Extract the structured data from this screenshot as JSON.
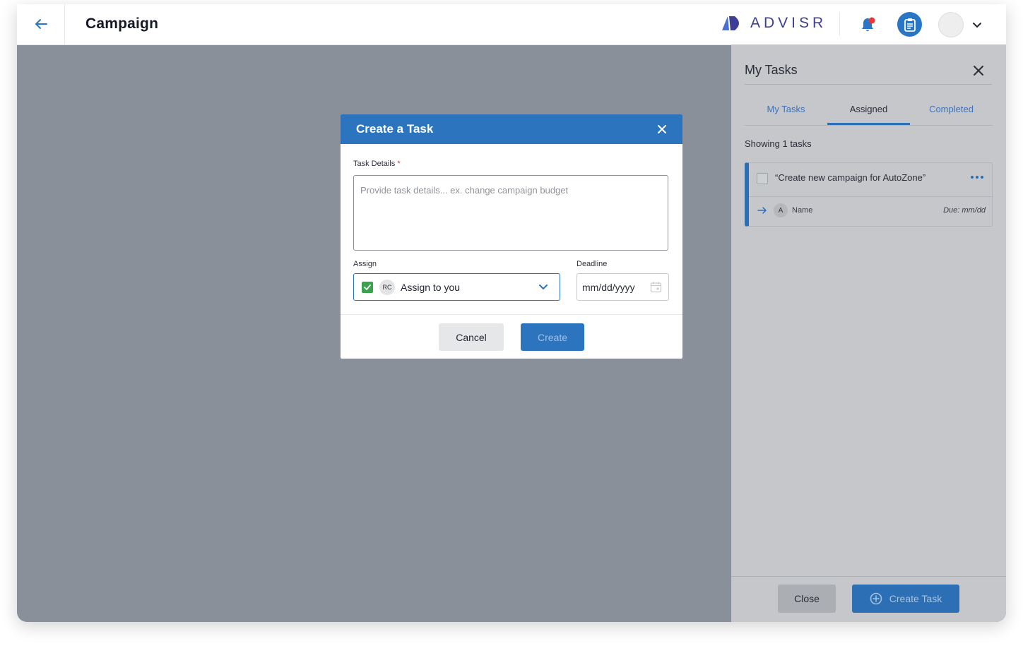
{
  "header": {
    "title": "Campaign",
    "brand": "ADVISR"
  },
  "modal": {
    "title": "Create a Task",
    "task_details_label": "Task Details",
    "required_mark": "*",
    "task_details_placeholder": "Provide task details... ex. change campaign budget",
    "assign_label": "Assign",
    "assign_initials": "RC",
    "assign_value": "Assign to you",
    "deadline_label": "Deadline",
    "deadline_placeholder": "mm/dd/yyyy",
    "cancel_label": "Cancel",
    "create_label": "Create"
  },
  "panel": {
    "title": "My Tasks",
    "tabs": [
      "My Tasks",
      "Assigned",
      "Completed"
    ],
    "active_tab": "Assigned",
    "showing_text": "Showing 1 tasks",
    "tasks": [
      {
        "title": "“Create new campaign for AutoZone”",
        "assignee_initial": "A",
        "assignee_name": "Name",
        "due": "Due: mm/dd"
      }
    ],
    "close_label": "Close",
    "create_task_label": "Create Task"
  },
  "colors": {
    "primary": "#2d74bf",
    "overlay": "#8a9099",
    "notification_dot": "#e53935",
    "check_green": "#3aa24b"
  },
  "icons": [
    "back-arrow-icon",
    "bell-icon",
    "clipboard-icon",
    "chevron-down-icon",
    "close-icon",
    "calendar-icon",
    "checkbox-icon",
    "more-icon",
    "arrow-right-icon",
    "plus-circle-icon"
  ]
}
